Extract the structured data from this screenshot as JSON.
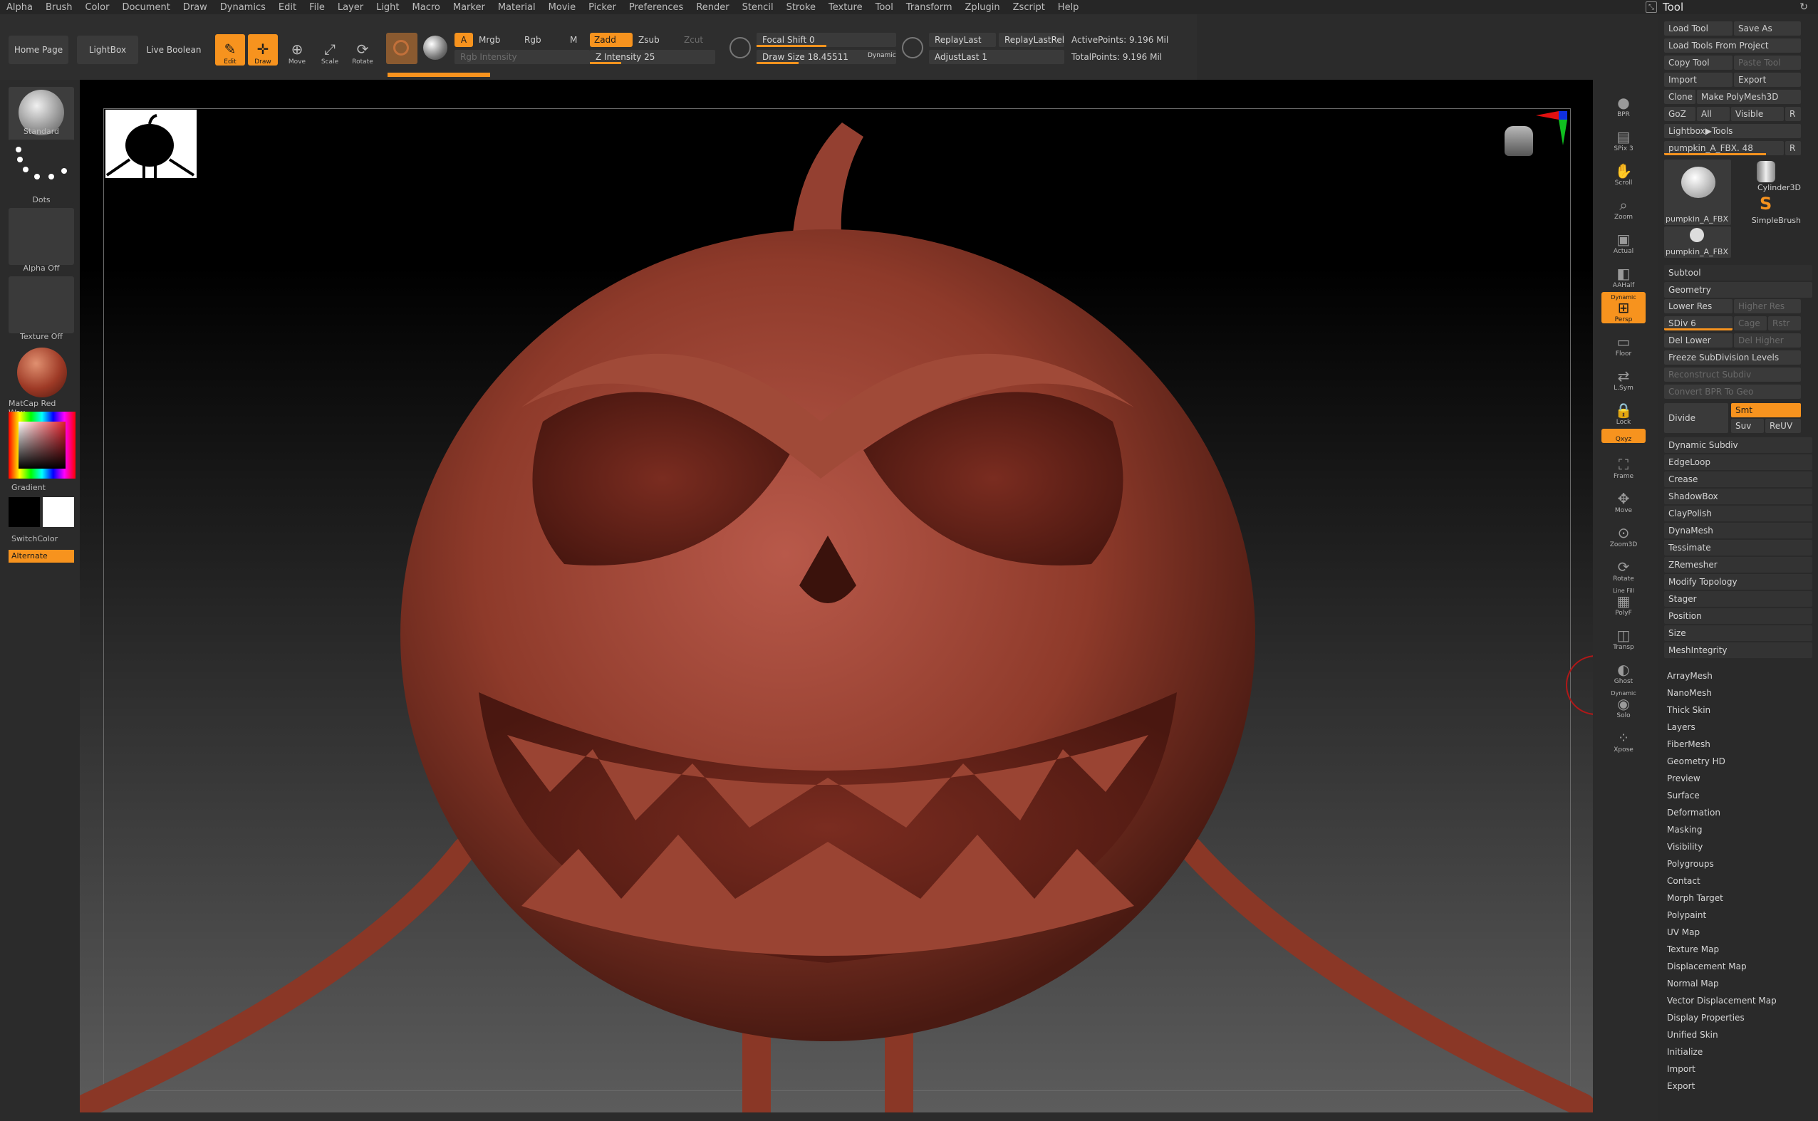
{
  "menu": [
    "Alpha",
    "Brush",
    "Color",
    "Document",
    "Draw",
    "Dynamics",
    "Edit",
    "File",
    "Layer",
    "Light",
    "Macro",
    "Marker",
    "Material",
    "Movie",
    "Picker",
    "Preferences",
    "Render",
    "Stencil",
    "Stroke",
    "Texture",
    "Tool",
    "Transform",
    "Zplugin",
    "Zscript",
    "Help"
  ],
  "tool_title": "Tool",
  "shelf": {
    "home_page": "Home Page",
    "lightbox": "LightBox",
    "live_boolean": "Live Boolean",
    "edit": "Edit",
    "draw": "Draw",
    "move": "Move",
    "scale": "Scale",
    "rotate": "Rotate",
    "a": "A",
    "mrgb": "Mrgb",
    "rgb": "Rgb",
    "m": "M",
    "rgb_intensity": "Rgb Intensity",
    "zadd": "Zadd",
    "zsub": "Zsub",
    "zcut": "Zcut",
    "z_intensity": "Z Intensity 25",
    "z_intensity_value": 25,
    "focal_shift": "Focal Shift 0",
    "focal_shift_value": 0,
    "draw_size": "Draw Size 18.45511",
    "draw_size_fill": 0.3,
    "dynamic": "Dynamic",
    "replay_last": "ReplayLast",
    "replay_last_rel": "ReplayLastRel",
    "adjust_last": "AdjustLast 1",
    "active_points": "ActivePoints: 9.196 Mil",
    "total_points": "TotalPoints: 9.196 Mil"
  },
  "left": {
    "brush": "Standard",
    "stroke": "Dots",
    "alpha": "Alpha Off",
    "texture": "Texture Off",
    "material": "MatCap Red Wax",
    "gradient": "Gradient",
    "switch_color": "SwitchColor",
    "alternate": "Alternate"
  },
  "right_icons": [
    {
      "label": "BPR",
      "icon": "sphere-icon"
    },
    {
      "label": "SPix 3",
      "icon": "spix-icon"
    },
    {
      "label": "Scroll",
      "icon": "hand-icon"
    },
    {
      "label": "Zoom",
      "icon": "zoom-icon"
    },
    {
      "label": "Actual",
      "icon": "actual-icon"
    },
    {
      "label": "AAHalf",
      "icon": "aahalf-icon"
    },
    {
      "label": "Persp",
      "icon": "persp-icon",
      "top": "Dynamic"
    },
    {
      "label": "Floor",
      "icon": "floor-icon"
    },
    {
      "label": "L.Sym",
      "icon": "lsym-icon"
    },
    {
      "label": "Lock",
      "icon": "lock-icon"
    },
    {
      "label": "Qxyz",
      "icon": "xyz-icon"
    },
    {
      "label": "Frame",
      "icon": "frame-icon"
    },
    {
      "label": "Move",
      "icon": "move-icon"
    },
    {
      "label": "Zoom3D",
      "icon": "zoom3d-icon"
    },
    {
      "label": "Rotate",
      "icon": "rotate-icon"
    },
    {
      "label": "PolyF",
      "icon": "polyf-icon",
      "top": "Line Fill"
    },
    {
      "label": "Transp",
      "icon": "transp-icon"
    },
    {
      "label": "Ghost",
      "icon": "ghost-icon"
    },
    {
      "label": "Solo",
      "icon": "solo-icon",
      "top": "Dynamic"
    },
    {
      "label": "Xpose",
      "icon": "xpose-icon"
    }
  ],
  "tool": {
    "load_tool": "Load Tool",
    "save_as": "Save As",
    "load_from_project": "Load Tools From Project",
    "copy_tool": "Copy Tool",
    "paste_tool": "Paste Tool",
    "import": "Import",
    "export": "Export",
    "clone": "Clone",
    "make_polymesh": "Make PolyMesh3D",
    "goz": "GoZ",
    "all": "All",
    "visible": "Visible",
    "r": "R",
    "lightbox_tools": "Lightbox▶Tools",
    "current_tool": "pumpkin_A_FBX. 48",
    "current_tool_fill": 0.85,
    "thumbs": [
      "pumpkin_A_FBX",
      "Cylinder3D",
      "SimpleBrush",
      "pumpkin_A_FBX"
    ],
    "subtool": "Subtool",
    "geometry": "Geometry",
    "lower_res": "Lower Res",
    "higher_res": "Higher Res",
    "sdiv": "SDiv 6",
    "cage": "Cage",
    "rstr": "Rstr",
    "del_lower": "Del Lower",
    "del_higher": "Del Higher",
    "freeze": "Freeze SubDivision Levels",
    "reconstruct": "Reconstruct Subdiv",
    "convert_bpr": "Convert BPR To Geo",
    "divide": "Divide",
    "smt": "Smt",
    "suv": "Suv",
    "reuv": "ReUV",
    "geometry_items": [
      "Dynamic Subdiv",
      "EdgeLoop",
      "Crease",
      "ShadowBox",
      "ClayPolish",
      "DynaMesh",
      "Tessimate",
      "ZRemesher",
      "Modify Topology",
      "Stager",
      "Position",
      "Size",
      "MeshIntegrity"
    ],
    "menus": [
      "ArrayMesh",
      "NanoMesh",
      "Thick Skin",
      "Layers",
      "FiberMesh",
      "Geometry HD",
      "Preview",
      "Surface",
      "Deformation",
      "Masking",
      "Visibility",
      "Polygroups",
      "Contact",
      "Morph Target",
      "Polypaint",
      "UV Map",
      "Texture Map",
      "Displacement Map",
      "Normal Map",
      "Vector Displacement Map",
      "Display Properties",
      "Unified Skin",
      "Initialize",
      "Import",
      "Export"
    ]
  },
  "colors": {
    "accent": "#f7931e",
    "pumpkin": "#8c3a28"
  }
}
